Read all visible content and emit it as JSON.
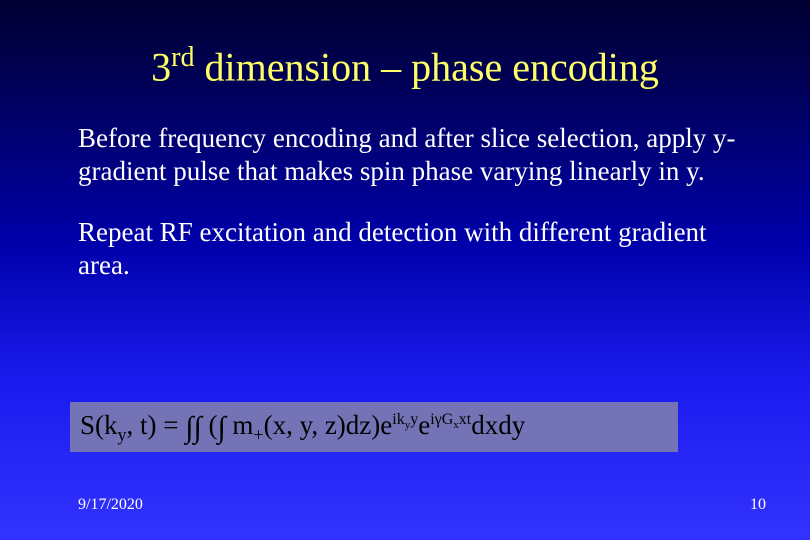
{
  "title": {
    "pre": "3",
    "sup": "rd",
    "post": " dimension – phase encoding"
  },
  "para1": "Before frequency encoding and after slice selection, apply y-gradient pulse that makes spin phase varying linearly in y.",
  "para2": "Repeat RF excitation and detection with different gradient area.",
  "formula": {
    "t1": "S(k",
    "sub1": "y",
    "t2": ", t) = ",
    "int1": "∫",
    "int2": "∫",
    "t3": " (",
    "int3": "∫",
    "t4": " m",
    "sub2": "+",
    "t5": "(x, y, z)dz)e",
    "sup1": "ik",
    "sup1a": "y",
    "sup1b": "y",
    "t6": "e",
    "sup2": "iγG",
    "sup2a": "x",
    "sup2b": "xt",
    "t7": "dxdy"
  },
  "footer": {
    "date": "9/17/2020",
    "page": "10"
  }
}
